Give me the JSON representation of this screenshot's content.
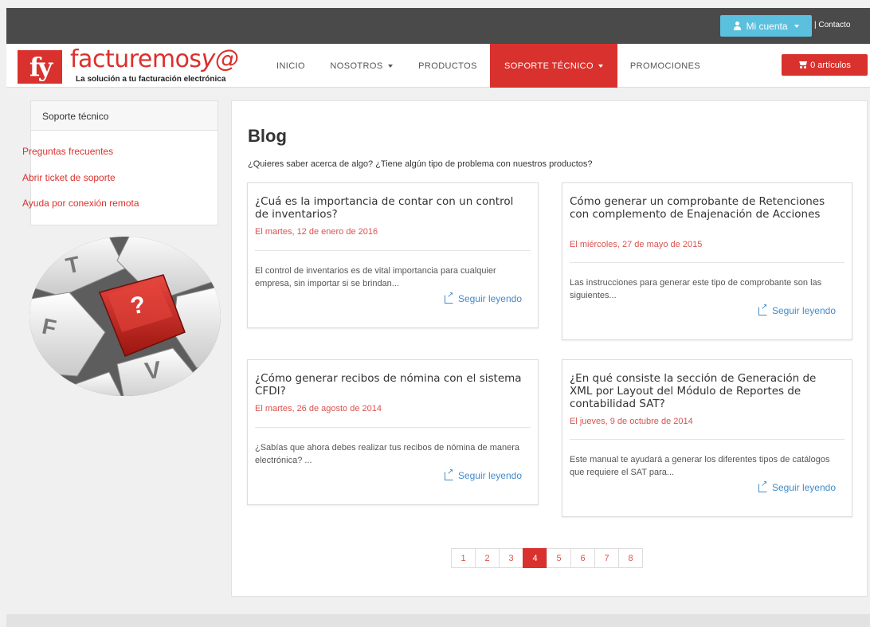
{
  "header": {
    "account_label": "Mi cuenta",
    "contact_label": "| Contacto",
    "cart_label": "0 artículos"
  },
  "logo": {
    "mark": "fy",
    "name_part1": "facturemos",
    "name_part2": "y@",
    "tagline": "La solución a tu facturación electrónica"
  },
  "nav": {
    "items": [
      {
        "label": "INICIO"
      },
      {
        "label": "NOSOTROS"
      },
      {
        "label": "PRODUCTOS"
      },
      {
        "label": "SOPORTE TÉCNICO"
      },
      {
        "label": "PROMOCIONES"
      }
    ],
    "active": "SOPORTE TÉCNICO"
  },
  "sidebar": {
    "title": "Soporte técnico",
    "links": [
      {
        "label": "Preguntas frecuentes"
      },
      {
        "label": "Abrir ticket de soporte"
      },
      {
        "label": "Ayuda por conexión remota"
      }
    ]
  },
  "main": {
    "title": "Blog",
    "subtitle": "¿Quieres saber acerca de algo? ¿Tiene algún tipo de problema con nuestros productos?",
    "posts": [
      {
        "title": "¿Cuá es la importancia de contar con un control de inventarios?",
        "date": "El martes, 12 de enero de 2016",
        "excerpt": "El control de inventarios es de vital importancia para cualquier empresa, sin importar si se brindan...",
        "more": "Seguir leyendo"
      },
      {
        "title": "Cómo generar un comprobante de Retenciones con complemento de Enajenación de Acciones",
        "date": "El miércoles, 27 de mayo de 2015",
        "excerpt": "Las instrucciones para generar este tipo de comprobante son las siguientes...",
        "more": "Seguir leyendo"
      },
      {
        "title": "¿Cómo generar recibos de nómina con el sistema CFDI?",
        "date": "El martes, 26 de agosto de 2014",
        "excerpt": "¿Sabías que ahora debes realizar tus recibos de nómina de manera electrónica? ...",
        "more": "Seguir leyendo"
      },
      {
        "title": "¿En qué consiste la sección de Generación de XML por Layout del Módulo de Reportes de contabilidad SAT?",
        "date": "El jueves, 9 de octubre de 2014",
        "excerpt": "Este manual te ayudará a generar los diferentes tipos de catálogos que requiere el SAT para...",
        "more": "Seguir leyendo"
      }
    ]
  },
  "pagination": {
    "pages": [
      "1",
      "2",
      "3",
      "4",
      "5",
      "6",
      "7",
      "8"
    ],
    "current": "4"
  },
  "colors": {
    "brand_red": "#d9312d",
    "account_blue": "#5bc0de",
    "topbar": "#4a4a4a",
    "link_blue": "#428bca"
  },
  "icons": [
    "user-icon",
    "cart-icon",
    "external-link-icon",
    "keyboard-question-image"
  ],
  "image_key_labels": {
    "t": "T",
    "f": "F",
    "v": "V",
    "q": "?"
  }
}
